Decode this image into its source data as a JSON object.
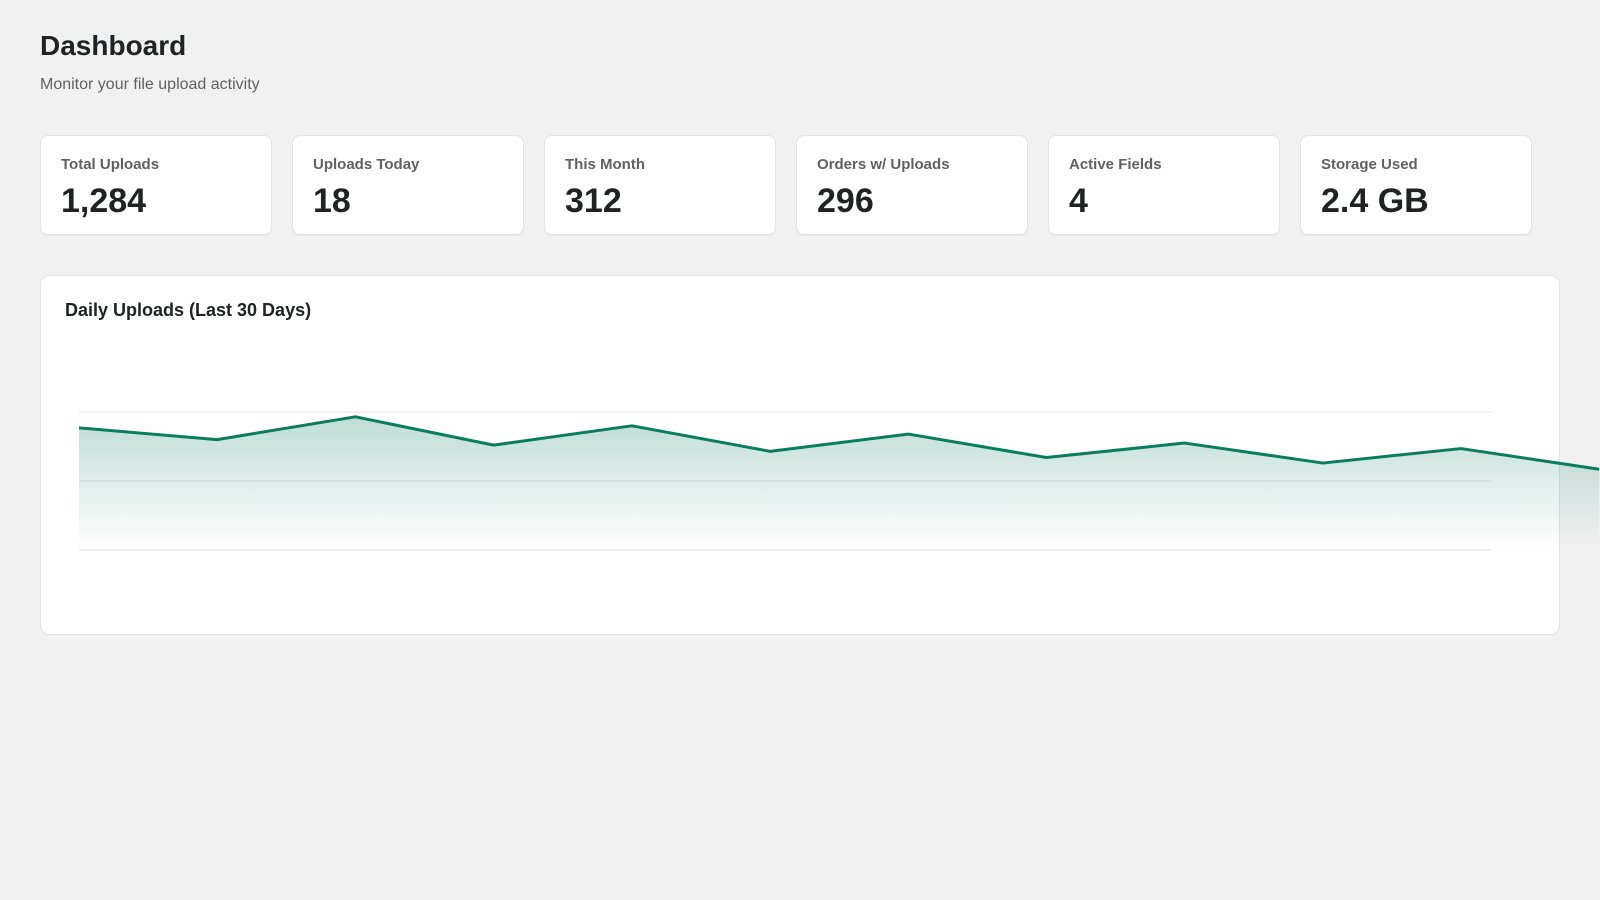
{
  "header": {
    "title": "Dashboard",
    "subtitle": "Monitor your file upload activity"
  },
  "stats": [
    {
      "label": "Total Uploads",
      "value": "1,284"
    },
    {
      "label": "Uploads Today",
      "value": "18"
    },
    {
      "label": "This Month",
      "value": "312"
    },
    {
      "label": "Orders w/ Uploads",
      "value": "296"
    },
    {
      "label": "Active Fields",
      "value": "4"
    },
    {
      "label": "Storage Used",
      "value": "2.4 GB"
    }
  ],
  "colors": {
    "accent": "#0a7d5e",
    "background": "#f1f1f1",
    "card": "#ffffff",
    "gridline": "#e3e3e3"
  },
  "chart_data": {
    "type": "area",
    "title": "Daily Uploads (Last 30 Days)",
    "xlabel": "",
    "ylabel": "",
    "grid": true,
    "gridlines": 3,
    "series": [
      {
        "values": [
          17.7,
          16.0,
          19.3,
          15.2,
          18.0,
          14.3,
          16.8,
          13.4,
          15.5,
          12.6,
          14.7,
          11.7
        ]
      }
    ],
    "ylim": [
      0,
      40
    ]
  }
}
